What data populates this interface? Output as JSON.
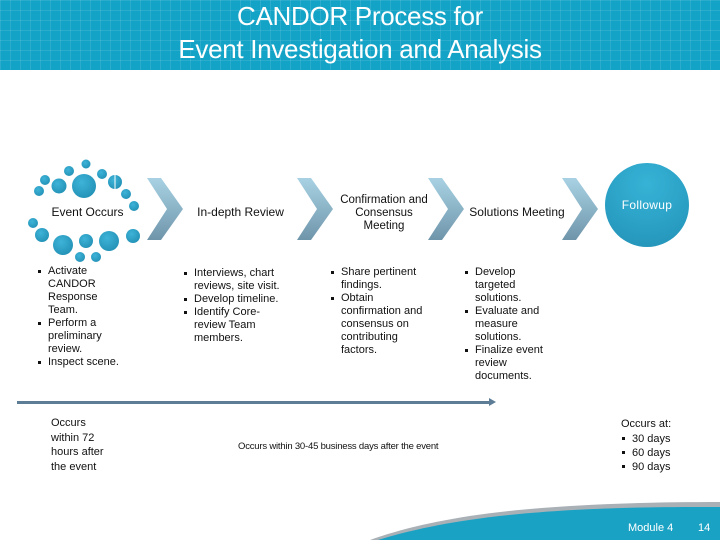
{
  "title": {
    "line1": "CANDOR Process for",
    "line2": "Event Investigation and Analysis"
  },
  "colors": {
    "banner": "#13a3c6",
    "dots": "#2a9fc4",
    "chevron_top": "#a8d2e4",
    "chevron_bottom": "#6f95aa",
    "timeline": "#5d7d96",
    "footer": "#1aa2c4"
  },
  "steps": [
    {
      "label": "Event Occurs",
      "icon": "dot-ring-icon",
      "bullets": [
        "Activate CANDOR Response Team.",
        "Perform a preliminary review.",
        "Inspect scene."
      ]
    },
    {
      "label": "In-depth Review",
      "bullets": [
        "Interviews, chart reviews, site visit.",
        "Develop timeline.",
        "Identify Core-review Team members."
      ]
    },
    {
      "label": "Confirmation and Consensus Meeting",
      "bullets": [
        "Share pertinent findings.",
        "Obtain confirmation and consensus on contributing factors."
      ]
    },
    {
      "label": "Solutions Meeting",
      "bullets": [
        "Develop targeted solutions.",
        "Evaluate and measure solutions.",
        "Finalize event review documents."
      ]
    },
    {
      "label": "Followup",
      "bullets": []
    }
  ],
  "timing": {
    "first": "Occurs within 72 hours after the event",
    "middle": "Occurs within 30-45 business days after the event",
    "last_heading": "Occurs at:",
    "last_items": [
      "30 days",
      "60 days",
      "90 days"
    ]
  },
  "footer": {
    "module": "Module 4",
    "page": "14"
  }
}
